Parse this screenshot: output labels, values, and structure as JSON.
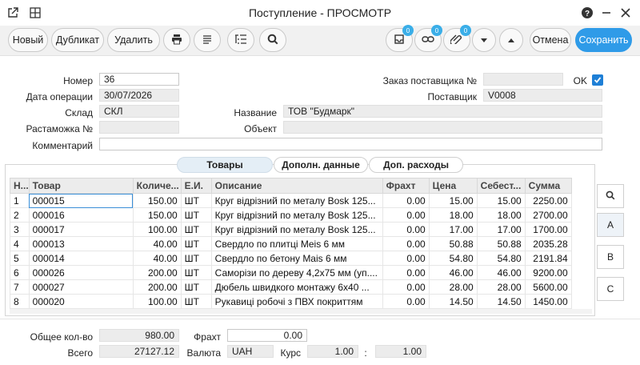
{
  "window": {
    "title": "Поступление - ПРОСМОТР"
  },
  "toolbar": {
    "new_label": "Новый",
    "duplicate_label": "Дубликат",
    "delete_label": "Удалить",
    "badge_count_1": "0",
    "badge_count_2": "0",
    "badge_count_3": "0",
    "cancel_label": "Отмена",
    "save_label": "Сохранить"
  },
  "form": {
    "number_label": "Номер",
    "number_value": "36",
    "date_label": "Дата операции",
    "date_value": "30/07/2026",
    "warehouse_label": "Склад",
    "warehouse_value": "СКЛ",
    "customs_label": "Растаможка №",
    "customs_value": "",
    "comment_label": "Комментарий",
    "comment_value": "",
    "supplier_order_label": "Заказ поставщика №",
    "supplier_order_value": "",
    "ok_label": "OK",
    "ok_checked": true,
    "supplier_label": "Поставщик",
    "supplier_value": "V0008",
    "name_label": "Название",
    "name_value": "ТОВ \"Будмарк\"",
    "object_label": "Объект",
    "object_value": ""
  },
  "tabs": [
    {
      "label": "Товары",
      "active": true
    },
    {
      "label": "Дополн. данные",
      "active": false
    },
    {
      "label": "Доп. расходы",
      "active": false
    }
  ],
  "grid": {
    "columns": [
      "Н...",
      "Товар",
      "Количе...",
      "Е.И.",
      "Описание",
      "Фрахт",
      "Цена",
      "Себест...",
      "Сумма"
    ],
    "rows": [
      [
        "1",
        "000015",
        "150.00",
        "ШТ",
        "Круг відрізний по металу Bosk 125...",
        "0.00",
        "15.00",
        "15.00",
        "2250.00"
      ],
      [
        "2",
        "000016",
        "150.00",
        "ШТ",
        "Круг відрізний по металу Bosk 125...",
        "0.00",
        "18.00",
        "18.00",
        "2700.00"
      ],
      [
        "3",
        "000017",
        "100.00",
        "ШТ",
        "Круг відрізний по металу Bosk 125...",
        "0.00",
        "17.00",
        "17.00",
        "1700.00"
      ],
      [
        "4",
        "000013",
        "40.00",
        "ШТ",
        "Свердло по плитці Meis 6 мм",
        "0.00",
        "50.88",
        "50.88",
        "2035.28"
      ],
      [
        "5",
        "000014",
        "40.00",
        "ШТ",
        "Свердло по бетону Mais 6 мм",
        "0.00",
        "54.80",
        "54.80",
        "2191.84"
      ],
      [
        "6",
        "000026",
        "200.00",
        "ШТ",
        "Саморізи по дереву 4,2x75 мм (уп....",
        "0.00",
        "46.00",
        "46.00",
        "9200.00"
      ],
      [
        "7",
        "000027",
        "200.00",
        "ШТ",
        "Дюбель швидкого монтажу 6x40 ...",
        "0.00",
        "28.00",
        "28.00",
        "5600.00"
      ],
      [
        "8",
        "000020",
        "100.00",
        "ШТ",
        "Рукавиці робочі з ПВХ покриттям",
        "0.00",
        "14.50",
        "14.50",
        "1450.00"
      ]
    ]
  },
  "side": {
    "a_label": "A",
    "b_label": "B",
    "c_label": "C"
  },
  "totals": {
    "qty_label": "Общее кол-во",
    "qty_value": "980.00",
    "total_label": "Всего",
    "total_value": "27127.12",
    "freight_label": "Фрахт",
    "freight_value": "0.00",
    "currency_label": "Валюта",
    "currency_value": "UAH",
    "rate_label": "Курс",
    "rate_value": "1.00",
    "rate_sep": ":",
    "rate_value2": "1.00"
  },
  "colors": {
    "accent": "#2f9be8",
    "checkbox": "#1e7fd6"
  }
}
